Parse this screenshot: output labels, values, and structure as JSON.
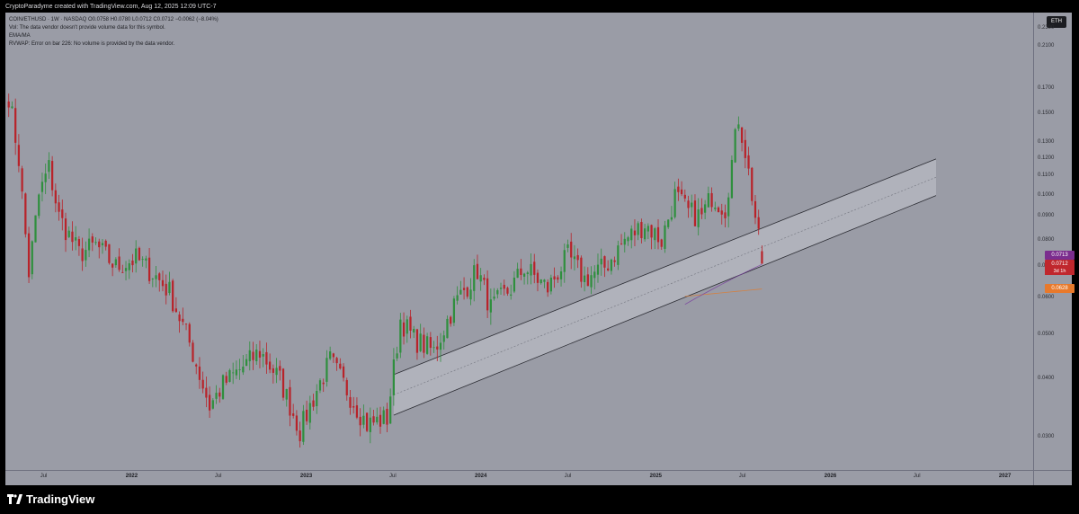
{
  "header": {
    "caption": "CryptoParadyme created with TradingView.com, Aug 12, 2025 12:09 UTC-7",
    "legend": [
      "COIN/ETHUSD · 1W · NASDAQ  O0.0758  H0.0780  L0.0712  C0.0712  −0.0062 (−8.04%)",
      "Vol: The data vendor doesn't provide volume data for this symbol.",
      "EMA/MA",
      "RVWAP: Error on bar 226: No volume is provided by the data vendor."
    ]
  },
  "currency_badge": "ETH",
  "price_tags": {
    "last_price": "0.0713",
    "close": "0.0712",
    "countdown": "3d 1h",
    "ma_value": "0.0628"
  },
  "brand": {
    "name": "TradingView",
    "icon": "tradingview-logo-icon"
  },
  "colors": {
    "background": "#9a9ca6",
    "up_candle": "#2f8f3e",
    "down_candle": "#b8232a",
    "channel_fill": "#c2c4cc",
    "ma_line": "#e07b2c",
    "ema_line": "#7b3fa0",
    "close_tag": "#c0272d",
    "last_tag": "#7b2d8e",
    "ma_tag": "#e8792b"
  },
  "chart_data": {
    "type": "candlestick",
    "title": "COIN/ETHUSD · 1W · NASDAQ",
    "yscale": "log",
    "ylim": [
      0.0255,
      0.24
    ],
    "yticks": [
      0.03,
      0.04,
      0.05,
      0.06,
      0.07,
      0.08,
      0.09,
      0.1,
      0.11,
      0.12,
      0.13,
      0.15,
      0.17,
      0.21,
      0.23
    ],
    "ytick_labels": [
      "0.0300",
      "0.0400",
      "0.0500",
      "0.0600",
      "0.0700",
      "0.0800",
      "0.0900",
      "0.1000",
      "0.1100",
      "0.1200",
      "0.1300",
      "0.1500",
      "0.1700",
      "0.2100",
      "0.2300"
    ],
    "xlim": [
      "2021-04-12",
      "2027-03-01"
    ],
    "xticks": [
      {
        "date": "2021-07-01",
        "label": "Jul",
        "bold": false
      },
      {
        "date": "2022-01-01",
        "label": "2022",
        "bold": true
      },
      {
        "date": "2022-07-01",
        "label": "Jul",
        "bold": false
      },
      {
        "date": "2023-01-01",
        "label": "2023",
        "bold": true
      },
      {
        "date": "2023-07-01",
        "label": "Jul",
        "bold": false
      },
      {
        "date": "2024-01-01",
        "label": "2024",
        "bold": true
      },
      {
        "date": "2024-07-01",
        "label": "Jul",
        "bold": false
      },
      {
        "date": "2025-01-01",
        "label": "2025",
        "bold": true
      },
      {
        "date": "2025-07-01",
        "label": "Jul",
        "bold": false
      },
      {
        "date": "2026-01-01",
        "label": "2026",
        "bold": true
      },
      {
        "date": "2026-07-01",
        "label": "Jul",
        "bold": false
      },
      {
        "date": "2027-01-01",
        "label": "2027",
        "bold": true
      }
    ],
    "anchors": [
      [
        "2021-04-19",
        0.165
      ],
      [
        "2021-05-10",
        0.12
      ],
      [
        "2021-05-31",
        0.068
      ],
      [
        "2021-06-21",
        0.1
      ],
      [
        "2021-07-12",
        0.115
      ],
      [
        "2021-08-02",
        0.09
      ],
      [
        "2021-09-13",
        0.075
      ],
      [
        "2021-10-18",
        0.078
      ],
      [
        "2021-11-29",
        0.07
      ],
      [
        "2022-01-10",
        0.073
      ],
      [
        "2022-02-14",
        0.068
      ],
      [
        "2022-03-21",
        0.062
      ],
      [
        "2022-05-02",
        0.048
      ],
      [
        "2022-06-13",
        0.035
      ],
      [
        "2022-07-11",
        0.039
      ],
      [
        "2022-08-15",
        0.042
      ],
      [
        "2022-09-26",
        0.046
      ],
      [
        "2022-11-07",
        0.04
      ],
      [
        "2022-12-19",
        0.031
      ],
      [
        "2023-01-23",
        0.038
      ],
      [
        "2023-02-20",
        0.044
      ],
      [
        "2023-03-27",
        0.038
      ],
      [
        "2023-05-08",
        0.032
      ],
      [
        "2023-06-19",
        0.033
      ],
      [
        "2023-07-17",
        0.054
      ],
      [
        "2023-08-14",
        0.049
      ],
      [
        "2023-09-25",
        0.046
      ],
      [
        "2023-11-06",
        0.058
      ],
      [
        "2023-12-25",
        0.069
      ],
      [
        "2024-01-22",
        0.057
      ],
      [
        "2024-03-04",
        0.063
      ],
      [
        "2024-04-01",
        0.07
      ],
      [
        "2024-05-20",
        0.063
      ],
      [
        "2024-07-01",
        0.074
      ],
      [
        "2024-08-05",
        0.066
      ],
      [
        "2024-09-16",
        0.07
      ],
      [
        "2024-10-28",
        0.08
      ],
      [
        "2024-12-09",
        0.087
      ],
      [
        "2025-01-13",
        0.08
      ],
      [
        "2025-02-10",
        0.1
      ],
      [
        "2025-03-10",
        0.092
      ],
      [
        "2025-04-07",
        0.09
      ],
      [
        "2025-04-28",
        0.1
      ],
      [
        "2025-05-26",
        0.094
      ],
      [
        "2025-06-23",
        0.148
      ],
      [
        "2025-07-07",
        0.125
      ],
      [
        "2025-07-28",
        0.09
      ],
      [
        "2025-08-11",
        0.0712
      ]
    ],
    "last_candle": {
      "open": 0.0758,
      "high": 0.078,
      "low": 0.0712,
      "close": 0.0712
    },
    "channel": {
      "lower": [
        [
          "2023-07-03",
          0.0335
        ],
        [
          "2026-08-10",
          0.1
        ]
      ],
      "upper": [
        [
          "2023-07-03",
          0.041
        ],
        [
          "2026-08-10",
          0.12
        ]
      ]
    }
  }
}
